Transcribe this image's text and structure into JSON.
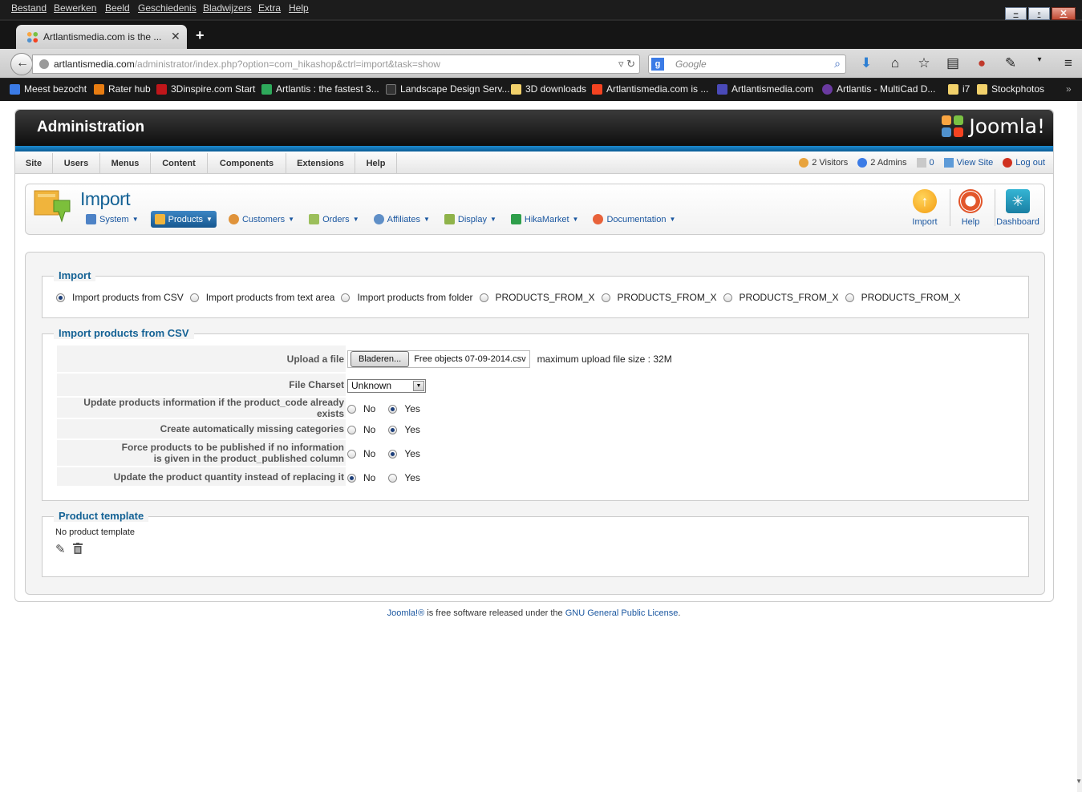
{
  "browser": {
    "menu": [
      "Bestand",
      "Bewerken",
      "Beeld",
      "Geschiedenis",
      "Bladwijzers",
      "Extra",
      "Help"
    ],
    "tab_title": "Artlantismedia.com is the ...",
    "url_host": "artlantismedia.com",
    "url_path": "/administrator/index.php?option=com_hikashop&ctrl=import&task=show",
    "search_placeholder": "Google",
    "bookmarks": [
      "Meest bezocht",
      "Rater hub",
      "3Dinspire.com Start",
      "Artlantis : the fastest 3...",
      "Landscape Design Serv...",
      "3D downloads",
      "Artlantismedia.com is ...",
      "Artlantismedia.com",
      "Artlantis - MultiCad D...",
      "i7",
      "Stockphotos"
    ],
    "bookmarks_overflow": "»"
  },
  "admin": {
    "header_title": "Administration",
    "logo_text": "Joomla!",
    "menu": [
      "Site",
      "Users",
      "Menus",
      "Content",
      "Components",
      "Extensions",
      "Help"
    ],
    "status": {
      "visitors": "2 Visitors",
      "admins": "2 Admins",
      "messages": "0",
      "view_site": "View Site",
      "logout": "Log out"
    }
  },
  "toolbar": {
    "page_title": "Import",
    "submenu": [
      "System",
      "Products",
      "Customers",
      "Orders",
      "Affiliates",
      "Display",
      "HikaMarket",
      "Documentation"
    ],
    "active_submenu": "Products",
    "buttons": [
      "Import",
      "Help",
      "Dashboard"
    ]
  },
  "import_section": {
    "legend": "Import",
    "options": [
      "Import products from CSV",
      "Import products from text area",
      "Import products from folder",
      "PRODUCTS_FROM_X",
      "PRODUCTS_FROM_X",
      "PRODUCTS_FROM_X",
      "PRODUCTS_FROM_X"
    ],
    "selected": "Import products from CSV"
  },
  "csv_section": {
    "legend": "Import products from CSV",
    "upload_label": "Upload a file",
    "browse_button": "Bladeren...",
    "file_name": "Free objects 07-09-2014.csv",
    "max_size": "maximum upload file size : 32M",
    "charset_label": "File Charset",
    "charset_value": "Unknown",
    "rows": [
      {
        "label_line1": "Update products information if the product_code already exists",
        "label_line2": "",
        "value": "Yes"
      },
      {
        "label_line1": "Create automatically missing categories",
        "label_line2": "",
        "value": "Yes"
      },
      {
        "label_line1": "Force products to be published if no information",
        "label_line2": "is given in the product_published column",
        "value": "Yes"
      },
      {
        "label_line1": "Update the product quantity instead of replacing it",
        "label_line2": "",
        "value": "No"
      }
    ],
    "no_label": "No",
    "yes_label": "Yes"
  },
  "template_section": {
    "legend": "Product template",
    "text": "No product template"
  },
  "footer": {
    "joomla_link": "Joomla!®",
    "middle": " is free software released under the ",
    "license_link": "GNU General Public License",
    "end": "."
  },
  "colors": {
    "title_blue": "#146295",
    "link_blue": "#1b57a0",
    "header_bar": "#1c8bd0"
  }
}
